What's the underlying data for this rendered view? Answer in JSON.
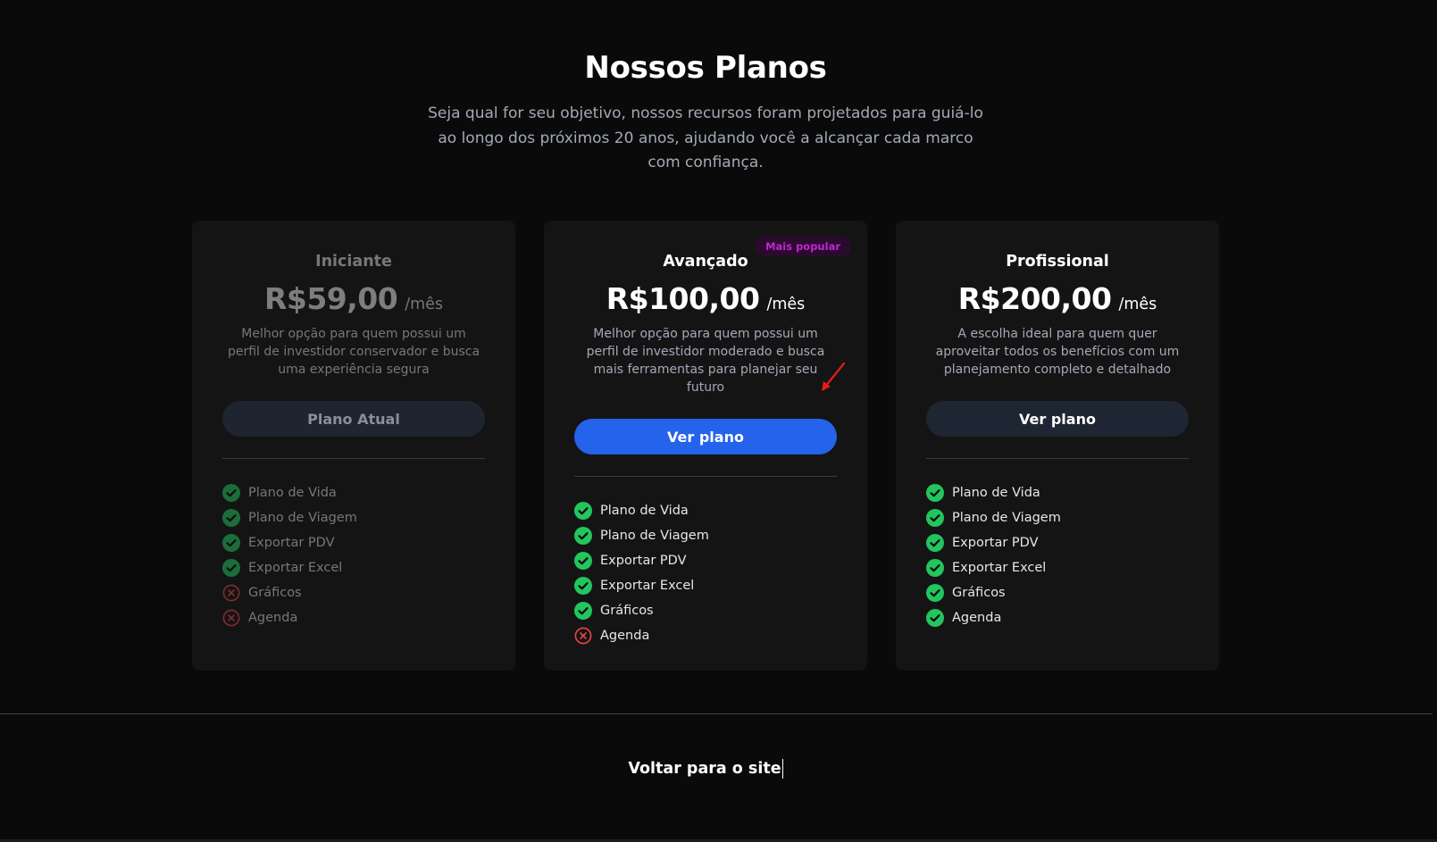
{
  "header": {
    "title": "Nossos Planos",
    "subtitle": "Seja qual for seu objetivo, nossos recursos foram projetados para guiá-lo ao longo dos próximos 20 anos, ajudando você a alcançar cada marco com confiança."
  },
  "plans": [
    {
      "name": "Iniciante",
      "price": "R$59,00",
      "per": "/mês",
      "description": "Melhor opção para quem possui um perfil de investidor conservador e busca uma experiência segura",
      "button": "Plano Atual",
      "features": [
        {
          "label": "Plano de Vida",
          "included": true
        },
        {
          "label": "Plano de Viagem",
          "included": true
        },
        {
          "label": "Exportar PDV",
          "included": true
        },
        {
          "label": "Exportar Excel",
          "included": true
        },
        {
          "label": "Gráficos",
          "included": false
        },
        {
          "label": "Agenda",
          "included": false
        }
      ]
    },
    {
      "name": "Avançado",
      "badge": "Mais popular",
      "price": "R$100,00",
      "per": "/mês",
      "description": "Melhor opção para quem possui um perfil de investidor moderado e busca mais ferramentas para planejar seu futuro",
      "button": "Ver plano",
      "features": [
        {
          "label": "Plano de Vida",
          "included": true
        },
        {
          "label": "Plano de Viagem",
          "included": true
        },
        {
          "label": "Exportar PDV",
          "included": true
        },
        {
          "label": "Exportar Excel",
          "included": true
        },
        {
          "label": "Gráficos",
          "included": true
        },
        {
          "label": "Agenda",
          "included": false
        }
      ]
    },
    {
      "name": "Profissional",
      "price": "R$200,00",
      "per": "/mês",
      "description": "A escolha ideal para quem quer aproveitar todos os benefícios com um planejamento completo e detalhado",
      "button": "Ver plano",
      "features": [
        {
          "label": "Plano de Vida",
          "included": true
        },
        {
          "label": "Plano de Viagem",
          "included": true
        },
        {
          "label": "Exportar PDV",
          "included": true
        },
        {
          "label": "Exportar Excel",
          "included": true
        },
        {
          "label": "Gráficos",
          "included": true
        },
        {
          "label": "Agenda",
          "included": true
        }
      ]
    }
  ],
  "footer": {
    "back_label": "Voltar para o site"
  },
  "colors": {
    "background": "#0a0a0a",
    "card": "#141414",
    "primary": "#2563eb",
    "check": "#22c55e",
    "cross": "#ef4444",
    "badge_text": "#c026d3",
    "annotation_arrow": "#e11d1d"
  },
  "icons": {
    "included": "check-circle-icon",
    "excluded": "x-circle-icon",
    "annotation": "red-arrow-icon"
  }
}
